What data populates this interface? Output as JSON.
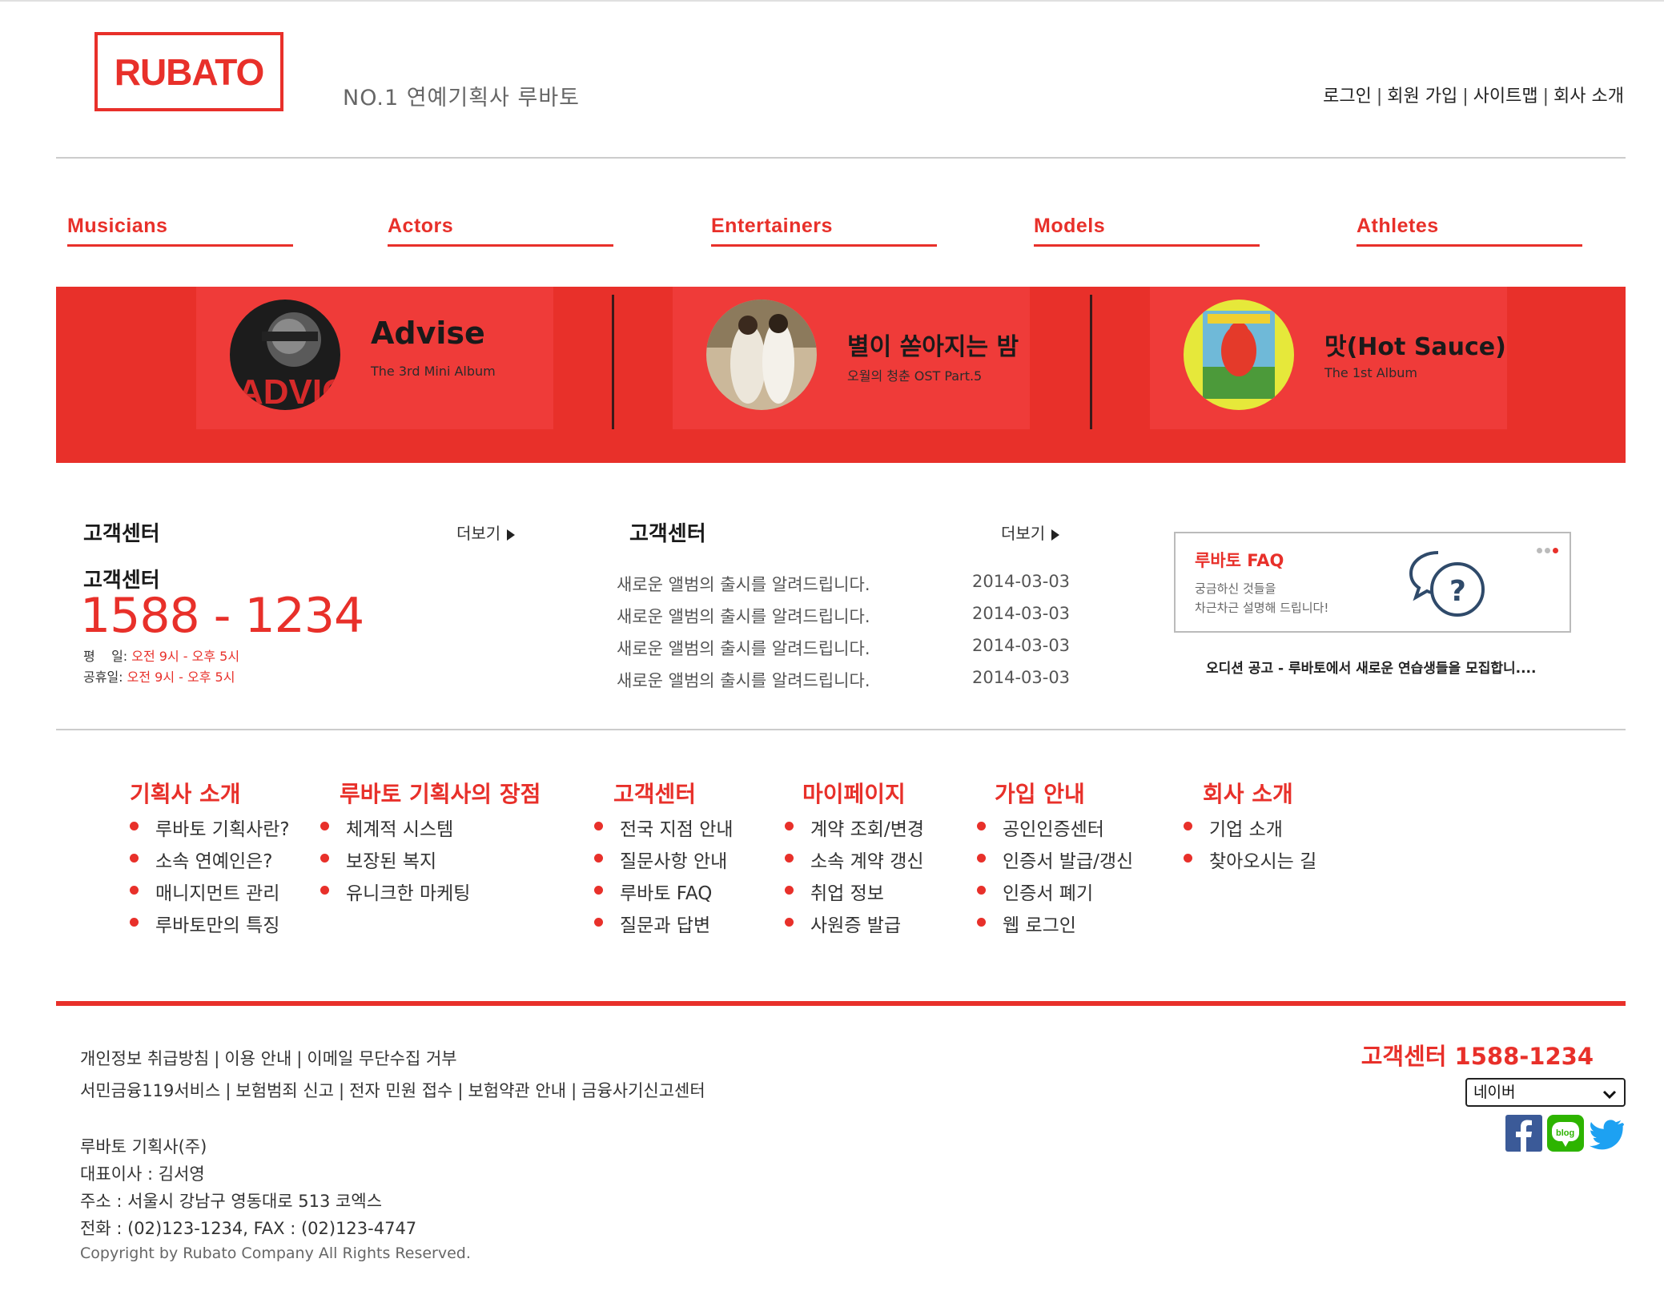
{
  "header": {
    "logo_text": "RUBATO",
    "tagline": "NO.1 연예기획사 루바토",
    "top_links": [
      "로그인",
      "회원 가입",
      "사이트맵",
      "회사 소개"
    ]
  },
  "nav": [
    "Musicians",
    "Actors",
    "Entertainers",
    "Models",
    "Athletes"
  ],
  "banner": [
    {
      "title": "Advise",
      "subtitle": "The 3rd Mini Album"
    },
    {
      "title": "별이 쏟아지는 밤",
      "subtitle": "오월의 청춘 OST Part.5"
    },
    {
      "title": "맛(Hot Sauce)",
      "subtitle": "The 1st Album"
    }
  ],
  "customer_center": {
    "title": "고객센터",
    "more": "더보기",
    "subtitle": "고객센터",
    "phone": "1588 - 1234",
    "weekday_label": "평    일:",
    "weekday_hours": "오전 9시 - 오후 5시",
    "holiday_label": "공휴일:",
    "holiday_hours": "오전 9시 - 오후 5시"
  },
  "notice": {
    "title": "고객센터",
    "more": "더보기",
    "items": [
      {
        "text": "새로운 앨범의 출시를 알려드립니다.",
        "date": "2014-03-03"
      },
      {
        "text": "새로운 앨범의 출시를 알려드립니다.",
        "date": "2014-03-03"
      },
      {
        "text": "새로운 앨범의 출시를 알려드립니다.",
        "date": "2014-03-03"
      },
      {
        "text": "새로운 앨범의 출시를 알려드립니다.",
        "date": "2014-03-03"
      }
    ]
  },
  "faq": {
    "title": "루바토 FAQ",
    "line1": "궁금하신 것들을",
    "line2": "차근차근 설명해 드립니다!",
    "caption": "오디션 공고 - 루바토에서 새로운 연습생들을 모집합니...."
  },
  "sitemap": [
    {
      "heading": "기획사 소개",
      "items": [
        "루바토 기획사란?",
        "소속 연예인은?",
        "매니지먼트 관리",
        "루바토만의 특징"
      ]
    },
    {
      "heading": "루바토 기획사의 장점",
      "items": [
        "체계적 시스템",
        "보장된 복지",
        "유니크한 마케팅"
      ]
    },
    {
      "heading": "고객센터",
      "items": [
        "전국 지점 안내",
        "질문사항 안내",
        "루바토 FAQ",
        "질문과 답변"
      ]
    },
    {
      "heading": "마이페이지",
      "items": [
        "계약 조회/변경",
        "소속 계약 갱신",
        "취업 정보",
        "사원증 발급"
      ]
    },
    {
      "heading": "가입 안내",
      "items": [
        "공인인증센터",
        "인증서 발급/갱신",
        "인증서 폐기",
        "웹 로그인"
      ]
    },
    {
      "heading": "회사 소개",
      "items": [
        "기업 소개",
        "찾아오시는 길"
      ]
    }
  ],
  "footer": {
    "links_row1": [
      "개인정보 취급방침",
      "이용 안내",
      "이메일 무단수집 거부"
    ],
    "links_row2": [
      "서민금융119서비스",
      "보험범죄 신고",
      "전자 민원 접수",
      "보험약관 안내",
      "금융사기신고센터"
    ],
    "company": "루바토 기획사(주)",
    "ceo": "대표이사 : 김서영",
    "address": "주소 : 서울시 강남구 영동대로 513 코엑스",
    "phone": "전화 : (02)123-1234, FAX : (02)123-4747",
    "copyright": "Copyright by Rubato Company All Rights Reserved.",
    "customer_center": "고객센터 1588-1234",
    "select_value": "네이버",
    "social": [
      "facebook-icon",
      "blog-icon",
      "twitter-icon"
    ]
  },
  "colors": {
    "accent": "#e8302a",
    "banner_bg": "#e8302a"
  }
}
